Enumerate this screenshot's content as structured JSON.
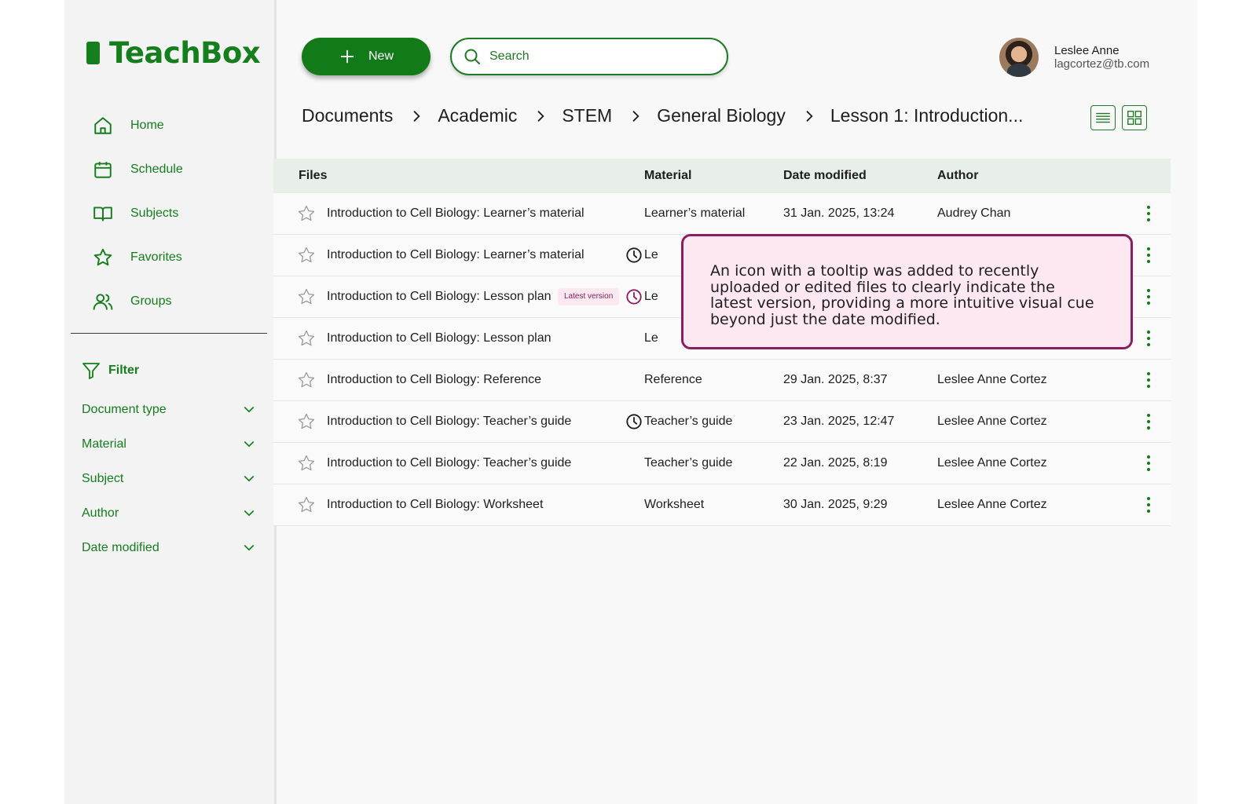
{
  "brand": {
    "name": "TeachBox",
    "color": "#157e1d"
  },
  "sidebar": {
    "nav": [
      {
        "label": "Home",
        "icon": "home-icon"
      },
      {
        "label": "Schedule",
        "icon": "calendar-icon"
      },
      {
        "label": "Subjects",
        "icon": "book-icon"
      },
      {
        "label": "Favorites",
        "icon": "star-icon"
      },
      {
        "label": "Groups",
        "icon": "users-icon"
      }
    ],
    "filter_title": "Filter",
    "filters": [
      "Document type",
      "Material",
      "Subject",
      "Author",
      "Date modified"
    ]
  },
  "toolbar": {
    "new_label": "New",
    "search_placeholder": "Search"
  },
  "user": {
    "name": "Leslee Anne",
    "email": "lagcortez@tb.com"
  },
  "breadcrumb": [
    "Documents",
    "Academic",
    "STEM",
    "General Biology",
    "Lesson 1: Introduction..."
  ],
  "table": {
    "headers": {
      "files": "Files",
      "material": "Material",
      "date": "Date modified",
      "author": "Author"
    },
    "rows": [
      {
        "name": "Introduction to Cell Biology: Learner’s material",
        "material": "Learner’s material",
        "date": "31 Jan. 2025, 13:24",
        "author": "Audrey Chan",
        "recent": false
      },
      {
        "name": "Introduction to Cell Biology: Learner’s material",
        "material": "Le",
        "date": "",
        "author": "",
        "recent": true
      },
      {
        "name": "Introduction to Cell Biology: Lesson plan",
        "material": "Le",
        "date": "",
        "author": "",
        "recent": true,
        "badge": "Latest version"
      },
      {
        "name": "Introduction to Cell Biology: Lesson plan",
        "material": "Le",
        "date": "",
        "author": "",
        "recent": false
      },
      {
        "name": "Introduction to Cell Biology: Reference",
        "material": "Reference",
        "date": "29 Jan. 2025, 8:37",
        "author": "Leslee Anne Cortez",
        "recent": false
      },
      {
        "name": "Introduction to Cell Biology: Teacher’s guide",
        "material": "Teacher’s guide",
        "date": "23 Jan. 2025, 12:47",
        "author": "Leslee Anne Cortez",
        "recent": true
      },
      {
        "name": "Introduction to Cell Biology: Teacher’s guide",
        "material": "Teacher’s guide",
        "date": "22 Jan. 2025, 8:19",
        "author": "Leslee Anne Cortez",
        "recent": false
      },
      {
        "name": "Introduction to Cell Biology: Worksheet",
        "material": "Worksheet",
        "date": "30 Jan. 2025, 9:29",
        "author": "Leslee Anne Cortez",
        "recent": false
      }
    ]
  },
  "callout": {
    "lines": [
      "An icon with a tooltip was added to recently",
      "uploaded or edited files to clearly indicate the",
      "latest version, providing a more intuitive visual cue",
      "beyond just the date modified."
    ]
  },
  "colors": {
    "accent": "#157e1d",
    "callout_border": "#8b1f5e",
    "callout_bg": "#fde8f2",
    "header_bg": "#e8efe8"
  }
}
